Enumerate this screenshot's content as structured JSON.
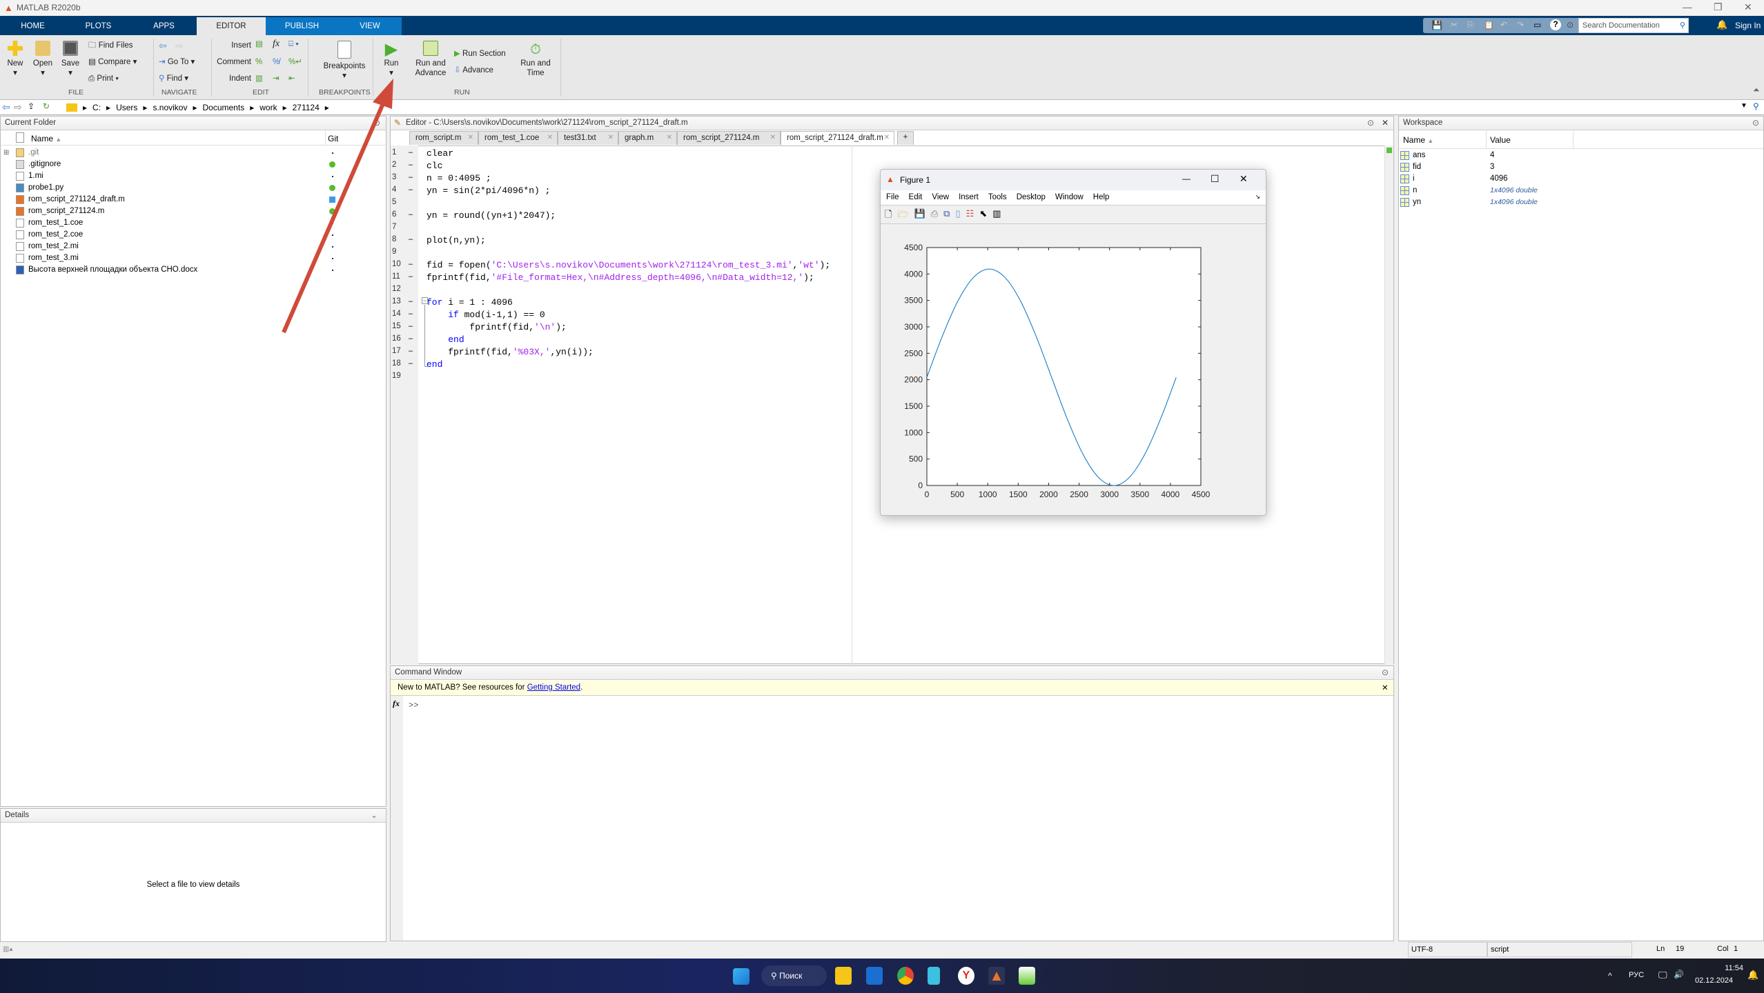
{
  "app": {
    "title": "MATLAB R2020b"
  },
  "ribbon_tabs": [
    "HOME",
    "PLOTS",
    "APPS",
    "EDITOR",
    "PUBLISH",
    "VIEW"
  ],
  "toolstrip": {
    "new": "New",
    "open": "Open",
    "save": "Save",
    "find_files": "Find Files",
    "compare": "Compare",
    "print": "Print",
    "go_to": "Go To",
    "find": "Find",
    "insert": "Insert",
    "comment": "Comment",
    "indent": "Indent",
    "breakpoints": "Breakpoints",
    "run": "Run",
    "run_and_advance_1": "Run and",
    "run_and_advance_2": "Advance",
    "run_section": "Run Section",
    "advance": "Advance",
    "run_and_time_1": "Run and",
    "run_and_time_2": "Time",
    "fx": "fx",
    "groups": {
      "file": "FILE",
      "navigate": "NAVIGATE",
      "edit": "EDIT",
      "breakpoints": "BREAKPOINTS",
      "run": "RUN"
    }
  },
  "search": {
    "placeholder": "Search Documentation"
  },
  "sign_in": "Sign In",
  "address": [
    "C:",
    "Users",
    "s.novikov",
    "Documents",
    "work",
    "271124"
  ],
  "current_folder": {
    "title": "Current Folder",
    "col_name": "Name",
    "col_git": "Git",
    "files": [
      {
        "name": ".git",
        "icon": "folder",
        "git": "dot"
      },
      {
        "name": ".gitignore",
        "icon": "settings-file",
        "git": "green"
      },
      {
        "name": "1.mi",
        "icon": "file",
        "git": "dot"
      },
      {
        "name": "probe1.py",
        "icon": "python-file",
        "git": "green"
      },
      {
        "name": "rom_script_271124_draft.m",
        "icon": "matlab-file",
        "git": "blue"
      },
      {
        "name": "rom_script_271124.m",
        "icon": "matlab-file",
        "git": "green"
      },
      {
        "name": "rom_test_1.coe",
        "icon": "file",
        "git": "dot"
      },
      {
        "name": "rom_test_2.coe",
        "icon": "file",
        "git": "dot"
      },
      {
        "name": "rom_test_2.mi",
        "icon": "file",
        "git": "dot"
      },
      {
        "name": "rom_test_3.mi",
        "icon": "file",
        "git": "dot"
      },
      {
        "name": "Высота верхней площадки объекта СНО.docx",
        "icon": "word-file",
        "git": "dot"
      }
    ]
  },
  "details": {
    "title": "Details",
    "message": "Select a file to view details"
  },
  "editor": {
    "title": "Editor - C:\\Users\\s.novikov\\Documents\\work\\271124\\rom_script_271124_draft.m",
    "tabs": [
      "rom_script.m",
      "rom_test_1.coe",
      "test31.txt",
      "graph.m",
      "rom_script_271124.m",
      "rom_script_271124_draft.m"
    ],
    "add_tab": "+",
    "lines": [
      [
        {
          "t": "clear"
        }
      ],
      [
        {
          "t": "clc"
        }
      ],
      [
        {
          "t": "n = 0:4095 ;"
        }
      ],
      [
        {
          "t": "yn = sin(2*pi/4096*n) ;"
        }
      ],
      [],
      [
        {
          "t": "yn = round((yn+1)*2047);"
        }
      ],
      [],
      [
        {
          "t": "plot(n,yn);"
        }
      ],
      [],
      [
        {
          "t": "fid = fopen("
        },
        {
          "t": "'C:\\Users\\s.novikov\\Documents\\work\\271124\\rom_test_3.mi'",
          "c": "str"
        },
        {
          "t": ","
        },
        {
          "t": "'wt'",
          "c": "str"
        },
        {
          "t": ");"
        }
      ],
      [
        {
          "t": "fprintf(fid,"
        },
        {
          "t": "'#File_format=Hex,\\n#Address_depth=4096,\\n#Data_width=12,'",
          "c": "str"
        },
        {
          "t": ");"
        }
      ],
      [],
      [
        {
          "t": "for",
          "c": "kw"
        },
        {
          "t": " i = 1 : 4096"
        }
      ],
      [
        {
          "t": "    "
        },
        {
          "t": "if",
          "c": "kw"
        },
        {
          "t": " mod(i-1,1) == 0"
        }
      ],
      [
        {
          "t": "        fprintf(fid,"
        },
        {
          "t": "'\\n'",
          "c": "str"
        },
        {
          "t": ");"
        }
      ],
      [
        {
          "t": "    "
        },
        {
          "t": "end",
          "c": "kw"
        }
      ],
      [
        {
          "t": "    fprintf(fid,"
        },
        {
          "t": "'%03X,'",
          "c": "str"
        },
        {
          "t": ",yn(i));"
        }
      ],
      [
        {
          "t": "end",
          "c": "kw"
        }
      ],
      []
    ],
    "executable": [
      1,
      2,
      3,
      4,
      6,
      8,
      10,
      11,
      13,
      14,
      15,
      16,
      17,
      18
    ]
  },
  "command_window": {
    "title": "Command Window",
    "banner": "New to MATLAB? See resources for ",
    "link": "Getting Started",
    "banner_end": ".",
    "prompt": ">>"
  },
  "workspace": {
    "title": "Workspace",
    "col_name": "Name",
    "col_value": "Value",
    "vars": [
      {
        "name": "ans",
        "value": "4"
      },
      {
        "name": "fid",
        "value": "3"
      },
      {
        "name": "i",
        "value": "4096"
      },
      {
        "name": "n",
        "value": "1x4096 double"
      },
      {
        "name": "yn",
        "value": "1x4096 double"
      }
    ]
  },
  "figure": {
    "title": "Figure 1",
    "menu": [
      "File",
      "Edit",
      "View",
      "Insert",
      "Tools",
      "Desktop",
      "Window",
      "Help"
    ]
  },
  "chart_data": {
    "type": "line",
    "title": "",
    "xlabel": "",
    "ylabel": "",
    "xlim": [
      0,
      4500
    ],
    "ylim": [
      0,
      4500
    ],
    "xticks": [
      0,
      500,
      1000,
      1500,
      2000,
      2500,
      3000,
      3500,
      4000,
      4500
    ],
    "yticks": [
      0,
      500,
      1000,
      1500,
      2000,
      2500,
      3000,
      3500,
      4000,
      4500
    ],
    "series": [
      {
        "name": "yn",
        "color": "#0072bd",
        "x": [
          0,
          256,
          512,
          768,
          1024,
          1280,
          1536,
          1792,
          2048,
          2304,
          2560,
          2816,
          3072,
          3328,
          3584,
          3840,
          4095
        ],
        "y": [
          2047,
          2830,
          3494,
          3938,
          4094,
          3938,
          3494,
          2830,
          2047,
          1264,
          600,
          156,
          0,
          156,
          600,
          1264,
          2044
        ]
      }
    ]
  },
  "status": {
    "encoding": "UTF-8",
    "type": "script",
    "ln_label": "Ln",
    "ln": "19",
    "col_label": "Col",
    "col": "1"
  },
  "taskbar": {
    "search": "Поиск",
    "lang": "РУС",
    "time": "11:54",
    "date": "02.12.2024"
  },
  "colors": {
    "accent": "#003b6f",
    "annotation_arrow": "#d04a3a"
  }
}
